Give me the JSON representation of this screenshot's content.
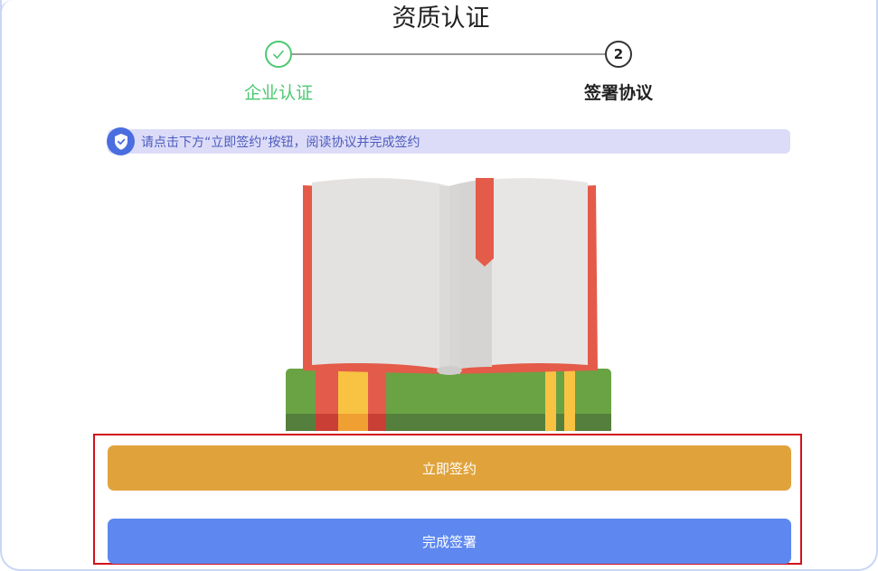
{
  "page": {
    "title": "资质认证"
  },
  "steps": [
    {
      "number": "1",
      "label": "企业认证",
      "status": "done",
      "icon": "check-icon"
    },
    {
      "number": "2",
      "label": "签署协议",
      "status": "active"
    }
  ],
  "notice": {
    "icon": "shield-check-icon",
    "text": "请点击下方“立即签约”按钮，阅读协议并完成签约"
  },
  "illustration": {
    "icon": "open-book-on-books"
  },
  "actions": {
    "sign_label": "立即签约",
    "finish_label": "完成签署"
  },
  "colors": {
    "success": "#4cc871",
    "notice_bg": "#dcdcf8",
    "notice_icon": "#4a6ee0",
    "sign_button": "#e0a33c",
    "finish_button": "#5e88f0",
    "highlight_border": "#d0121b"
  }
}
